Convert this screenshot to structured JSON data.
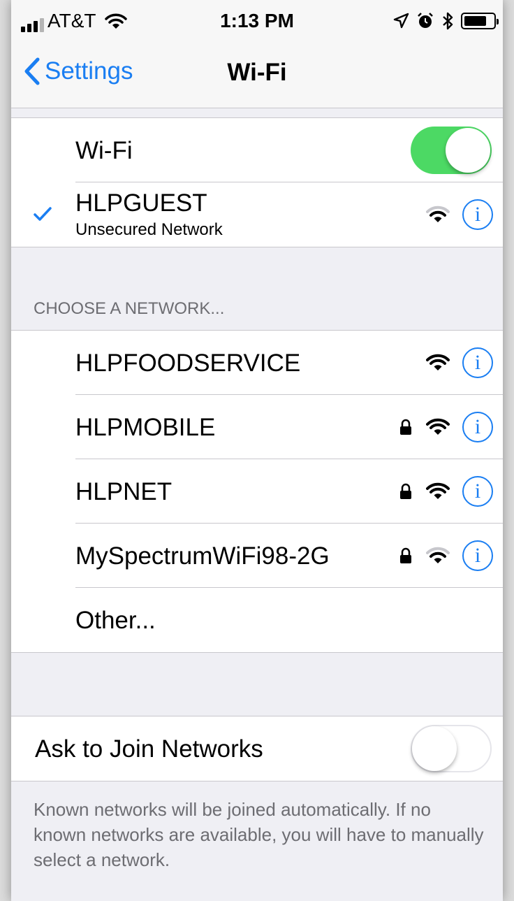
{
  "status_bar": {
    "carrier": "AT&T",
    "time": "1:13 PM"
  },
  "nav": {
    "back_label": "Settings",
    "title": "Wi-Fi"
  },
  "wifi_toggle": {
    "label": "Wi-Fi",
    "on": true
  },
  "connected": {
    "name": "HLPGUEST",
    "subtitle": "Unsecured Network"
  },
  "section_header": "CHOOSE A NETWORK...",
  "networks": [
    {
      "name": "HLPFOODSERVICE",
      "locked": false,
      "signal": "full"
    },
    {
      "name": "HLPMOBILE",
      "locked": true,
      "signal": "full"
    },
    {
      "name": "HLPNET",
      "locked": true,
      "signal": "full"
    },
    {
      "name": "MySpectrumWiFi98-2G",
      "locked": true,
      "signal": "medium"
    }
  ],
  "other_label": "Other...",
  "ask_to_join": {
    "label": "Ask to Join Networks",
    "on": false
  },
  "footer": "Known networks will be joined automatically. If no known networks are available, you will have to manually select a network.",
  "colors": {
    "accent": "#1a7ef2",
    "toggle_on": "#4cd964",
    "background": "#efeff4"
  }
}
